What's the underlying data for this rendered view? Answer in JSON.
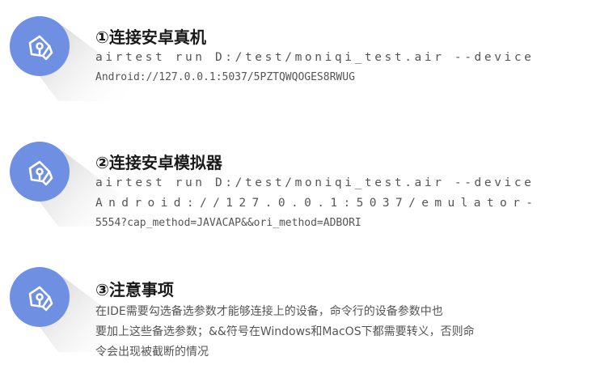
{
  "colors": {
    "badge": "#6f8fe3",
    "icon_stroke": "#ffffff",
    "title": "#1a1a1a",
    "body": "#555555"
  },
  "sections": [
    {
      "icon": "pen-nib-icon",
      "title": "①连接安卓真机",
      "lines": [
        "airtest run D:/test/moniqi_test.air --device",
        "Android://127.0.0.1:5037/5PZTQWQOGES8RWUG"
      ]
    },
    {
      "icon": "pen-nib-icon",
      "title": "②连接安卓模拟器",
      "lines": [
        "airtest run D:/test/moniqi_test.air --device",
        "Android://127.0.0.1:5037/emulator-",
        "5554?cap_method=JAVACAP&&ori_method=ADBORI"
      ]
    },
    {
      "icon": "pen-nib-icon",
      "title": "③注意事项",
      "lines": [
        "在IDE需要勾选备选参数才能够连接上的设备，命令行的设备参数中也",
        "要加上这些备选参数；&&符号在Windows和MacOS下都需要转义，否则命",
        "令会出现被截断的情况"
      ]
    }
  ]
}
